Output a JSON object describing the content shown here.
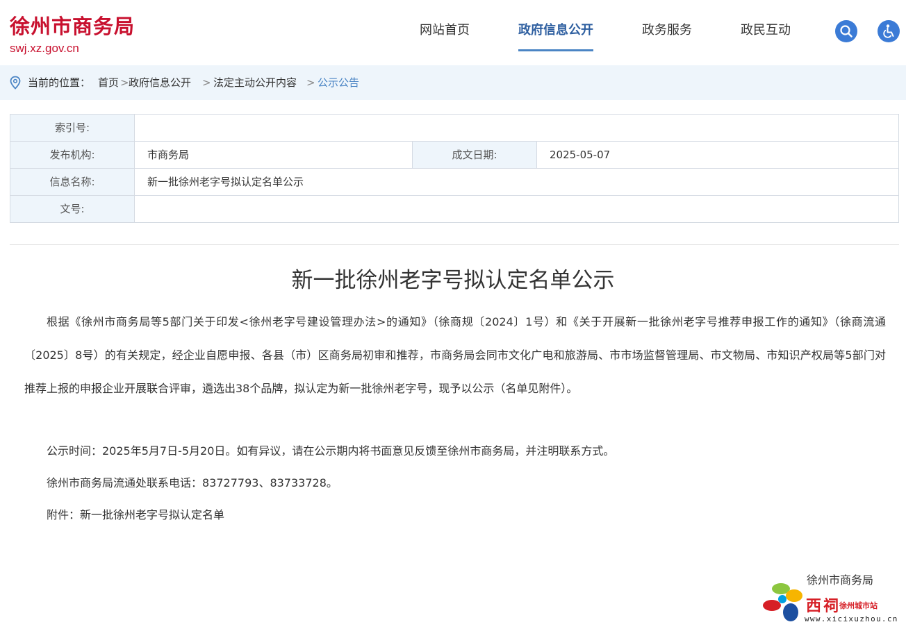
{
  "header": {
    "site_title": "徐州市商务局",
    "site_domain": "swj.xz.gov.cn",
    "nav": [
      "网站首页",
      "政府信息公开",
      "政务服务",
      "政民互动"
    ],
    "active_nav": "政府信息公开",
    "accent_color": "#4a84c4",
    "brand_color": "#c8102e"
  },
  "breadcrumb": {
    "label": "当前的位置：",
    "items": [
      "首页",
      "政府信息公开",
      "法定主动公开内容",
      "公示公告"
    ],
    "separator": ">"
  },
  "meta": {
    "index_label": "索引号:",
    "index_value": "",
    "org_label": "发布机构:",
    "org_value": "市商务局",
    "date_label": "成文日期:",
    "date_value": "2025-05-07",
    "name_label": "信息名称:",
    "name_value": "新一批徐州老字号拟认定名单公示",
    "doc_label": "文号:",
    "doc_value": ""
  },
  "article": {
    "title": "新一批徐州老字号拟认定名单公示",
    "paragraphs": [
      "根据《徐州市商务局等5部门关于印发<徐州老字号建设管理办法>的通知》（徐商规〔2024〕1号）和《关于开展新一批徐州老字号推荐申报工作的通知》（徐商流通〔2025〕8号）的有关规定，经企业自愿申报、各县（市）区商务局初审和推荐，市商务局会同市文化广电和旅游局、市市场监督管理局、市文物局、市知识产权局等5部门对推荐上报的申报企业开展联合评审，遴选出38个品牌，拟认定为新一批徐州老字号，现予以公示（名单见附件）。",
      "公示时间：2025年5月7日-5月20日。如有异议，请在公示期内将书面意见反馈至徐州市商务局，并注明联系方式。",
      "徐州市商务局流通处联系电话：83727793、83733728。",
      "附件：新一批徐州老字号拟认定名单"
    ],
    "signature": "徐州市商务局"
  },
  "watermark": {
    "brand": "西祠",
    "city": "徐州城市站",
    "url": "www.xicixuzhou.cn"
  },
  "icons": [
    "location-pin-icon",
    "search-icon",
    "accessibility-icon"
  ]
}
